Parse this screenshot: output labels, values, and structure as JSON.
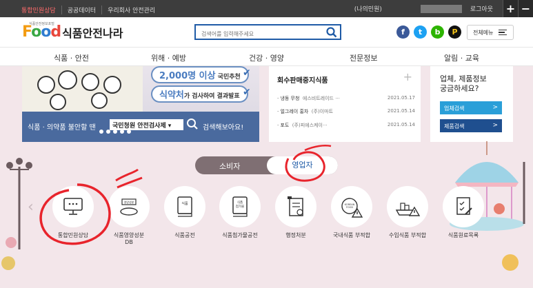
{
  "topbar": {
    "links": [
      "통합민원상담",
      "공공데이터",
      "우리회사 안전관리"
    ],
    "account": "(나의민원)",
    "logout": "로그아웃",
    "plus": "+",
    "minus": "−"
  },
  "header": {
    "logo_food": [
      "F",
      "o",
      "o",
      "d"
    ],
    "logo_name": "식품안전나라",
    "logo_mini": "식품안전정보포털",
    "search_placeholder": "검색어를 입력해주세요",
    "sns": [
      "f",
      "t",
      "b",
      "P"
    ],
    "allmenu": "전체메뉴"
  },
  "nav": [
    "식품 · 안전",
    "위해 · 예방",
    "건강 · 영양",
    "전문정보",
    "알림 · 교육"
  ],
  "banner": {
    "pill1": "2,000명 이상",
    "pill1_small": " 국민추천",
    "pill2": "식약처",
    "pill2_small": "가 검사하여 결과발표",
    "bottom_left": "식품 · 의약품 불안할 땐",
    "bottom_box": "국민청원 안전검사제 ▾",
    "bottom_right": "검색해보아요!"
  },
  "recall": {
    "title": "회수판매중지식품",
    "plus": "+",
    "items": [
      {
        "name": "냉동 무청",
        "company": "에스비트레이드 ···",
        "date": "2021.05.17"
      },
      {
        "name": "얼그레이 홍차",
        "company": "(주)이마트",
        "date": "2021.05.14"
      },
      {
        "name": "포도",
        "company": "(주)피에스케이···",
        "date": "2021.05.14"
      }
    ]
  },
  "info": {
    "title_line1": "업체, 제품정보",
    "title_line2": "궁금하세요?",
    "btn1": "업체검색",
    "btn2": "제품검색",
    "btn_arrow": ">",
    "colors": {
      "btn1": "#2a9fd8",
      "btn2": "#1f4f8f"
    }
  },
  "toggle": {
    "left": "소비자",
    "right": "영업자"
  },
  "services": [
    {
      "label": "통합민원상담",
      "icon": "monitor-chat-icon"
    },
    {
      "label": "식품영양성분\nDB",
      "icon": "nutrition-plate-icon",
      "icon_text": "영양성분"
    },
    {
      "label": "식품공전",
      "icon": "food-book-icon",
      "icon_text": "식품"
    },
    {
      "label": "식품첨가물공전",
      "icon": "additive-book-icon",
      "icon_text": "식품\n첨가물"
    },
    {
      "label": "행정처분",
      "icon": "administrative-document-icon"
    },
    {
      "label": "국내식품 부적합",
      "icon": "korean-food-warning-icon",
      "icon_text": "KOREAN\nFOOD"
    },
    {
      "label": "수입식품 부적합",
      "icon": "import-ship-warning-icon"
    },
    {
      "label": "식품원료목록",
      "icon": "ingredient-checklist-icon"
    }
  ],
  "colors": {
    "accent": "#1e5aa6",
    "annotation": "#e8242c",
    "background": "#f3e6ea"
  }
}
